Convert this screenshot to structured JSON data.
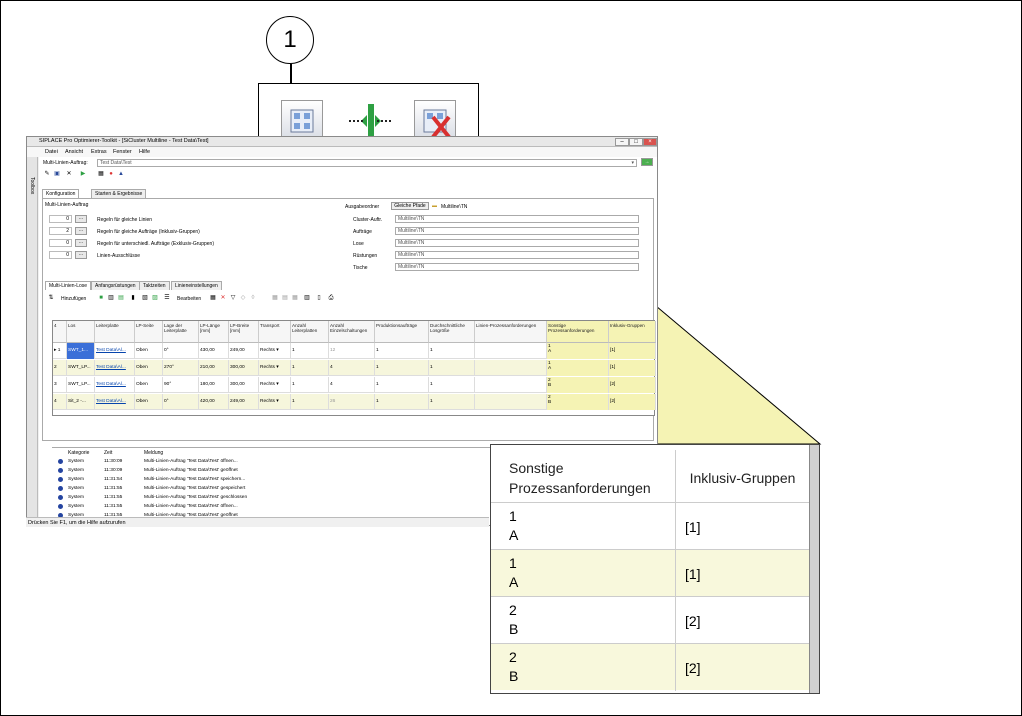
{
  "callout_number": "1",
  "window": {
    "title": "SIPLACE Pro Optimierer-Toolkit - [SiCluster Multiline - Test Data\\Test]"
  },
  "sidebar": {
    "label": "Toolbox"
  },
  "menu": [
    "Datei",
    "Ansicht",
    "Extras",
    "Fenster",
    "Hilfe"
  ],
  "job": {
    "label": "Multi-Linien-Auftrag:",
    "value": "Test Data\\Test"
  },
  "tabs": [
    "Konfiguration",
    "Starten & Ergebnisse"
  ],
  "section": {
    "title": "Multi-Linien-Auftrag",
    "ausgabeordner_label": "Ausgabeordner",
    "ausgabeordner_button": "Gleiche Pfade",
    "ausgabeordner_path": "Multiline\\TN"
  },
  "rules": [
    {
      "count": "0",
      "label": "Regeln für gleiche Linien"
    },
    {
      "count": "2",
      "label": "Regeln für gleiche Aufträge (Inklusiv-Gruppen)"
    },
    {
      "count": "0",
      "label": "Regeln für unterschiedl. Aufträge (Exklusiv-Gruppen)"
    },
    {
      "count": "0",
      "label": "Linien-Ausschlüsse"
    }
  ],
  "paths": [
    {
      "label": "Cluster-Auftr.",
      "value": "Multiline\\TN"
    },
    {
      "label": "Aufträge",
      "value": "Multiline\\TN"
    },
    {
      "label": "Lose",
      "value": "Multiline\\TN"
    },
    {
      "label": "Rüstungen",
      "value": "Multiline\\TN"
    },
    {
      "label": "Tische",
      "value": "Multiline\\TN"
    }
  ],
  "subtabs": [
    "Multi-Linien-Lose",
    "Anfangsrüstungen",
    "Taktzeiten",
    "Linieneinstellungen"
  ],
  "toolbar2": {
    "add": "Hinzufügen",
    "edit": "Bearbeiten"
  },
  "grid": {
    "headers": [
      "4",
      "Los",
      "Leiterplatte",
      "LP-Seite",
      "Lage der Leiterplatte",
      "LP-Länge [mm]",
      "LP-Breite [mm]",
      "Transport",
      "Anzahl Leiterplatten",
      "Anzahl Einzelschaltungen",
      "Produktionsaufträge",
      "Durchschnittliche Losgröße",
      "Linien-Prozessanforderungen",
      "Sonstige Prozessanforderungen",
      "Inklusiv-Gruppen"
    ],
    "rows": [
      [
        "1",
        "SWT_1...",
        "Test Data\\Al...",
        "Oben",
        "0°",
        "430,00",
        "249,00",
        "Rechts",
        "1",
        "12",
        "1",
        "1",
        "",
        "1\nA",
        "[1]"
      ],
      [
        "2",
        "SWT_LP...",
        "Test Data\\Al...",
        "Oben",
        "270°",
        "210,00",
        "300,00",
        "Rechts",
        "1",
        "4",
        "1",
        "1",
        "",
        "1\nA",
        "[1]"
      ],
      [
        "3",
        "SWT_LP...",
        "Test Data\\Al...",
        "Oben",
        "90°",
        "180,00",
        "300,00",
        "Rechts",
        "1",
        "4",
        "1",
        "1",
        "",
        "2\nB",
        "[2]"
      ],
      [
        "4",
        "Sit_2 -...",
        "Test Data\\Al...",
        "Oben",
        "0°",
        "420,00",
        "249,00",
        "Rechts",
        "1",
        "26",
        "1",
        "1",
        "",
        "2\nB",
        "[2]"
      ]
    ]
  },
  "log": {
    "headers": [
      "Kategorie",
      "Zeit",
      "Meldung"
    ],
    "rows": [
      [
        "System",
        "11:30:09",
        "Multi-Linien-Auftrag 'Test Data\\Test' öffnen..."
      ],
      [
        "System",
        "11:30:09",
        "Multi-Linien-Auftrag 'Test Data\\Test' geöffnet"
      ],
      [
        "System",
        "11:31:54",
        "Multi-Linien-Auftrag 'Test Data\\Test' speichern..."
      ],
      [
        "System",
        "11:31:55",
        "Multi-Linien-Auftrag 'Test Data\\Test' gespeichert"
      ],
      [
        "System",
        "11:31:55",
        "Multi-Linien-Auftrag 'Test Data\\Test' geschlossen"
      ],
      [
        "System",
        "11:31:55",
        "Multi-Linien-Auftrag 'Test Data\\Test' öffnen..."
      ],
      [
        "System",
        "11:31:55",
        "Multi-Linien-Auftrag 'Test Data\\Test' geöffnet"
      ]
    ]
  },
  "status": "Drücken Sie F1, um die Hilfe aufzurufen",
  "zoom": {
    "header1": "Sonstige Prozessanforderungen",
    "header2": "Inklusiv-Gruppen",
    "rows": [
      {
        "c1a": "1",
        "c1b": "A",
        "c2": "[1]"
      },
      {
        "c1a": "1",
        "c1b": "A",
        "c2": "[1]"
      },
      {
        "c1a": "2",
        "c1b": "B",
        "c2": "[2]"
      },
      {
        "c1a": "2",
        "c1b": "B",
        "c2": "[2]"
      }
    ]
  },
  "colors": {
    "highlight": "#f5f3b4",
    "row_alt": "#f6f6dc",
    "selected": "#3b6fd8",
    "link": "#0645ad"
  }
}
